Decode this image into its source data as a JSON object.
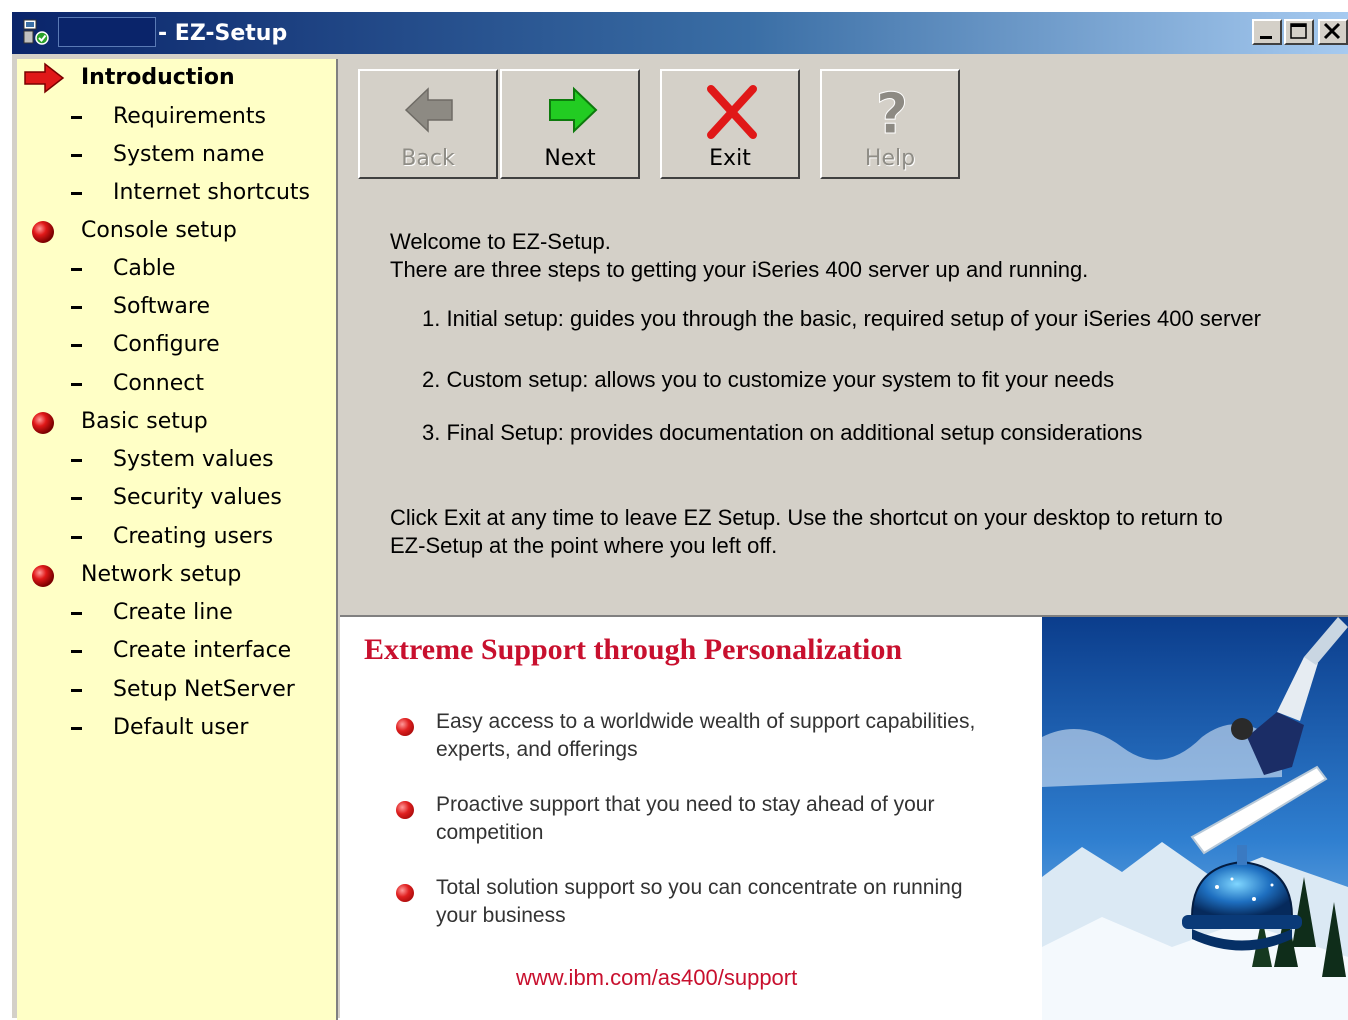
{
  "window": {
    "title": "- EZ-Setup",
    "controls": {
      "minimize": "_",
      "maximize": "□",
      "close": "✕"
    }
  },
  "sidebar": {
    "items": [
      {
        "label": "Introduction",
        "type": "section",
        "current": true
      },
      {
        "label": "Requirements",
        "type": "sub"
      },
      {
        "label": "System name",
        "type": "sub"
      },
      {
        "label": "Internet shortcuts",
        "type": "sub"
      },
      {
        "label": "Console setup",
        "type": "section"
      },
      {
        "label": "Cable",
        "type": "sub"
      },
      {
        "label": "Software",
        "type": "sub"
      },
      {
        "label": "Configure",
        "type": "sub"
      },
      {
        "label": "Connect",
        "type": "sub"
      },
      {
        "label": "Basic setup",
        "type": "section"
      },
      {
        "label": "System values",
        "type": "sub"
      },
      {
        "label": "Security values",
        "type": "sub"
      },
      {
        "label": "Creating users",
        "type": "sub"
      },
      {
        "label": "Network setup",
        "type": "section"
      },
      {
        "label": "Create line",
        "type": "sub"
      },
      {
        "label": "Create interface",
        "type": "sub"
      },
      {
        "label": "Setup NetServer",
        "type": "sub"
      },
      {
        "label": "Default user",
        "type": "sub"
      }
    ]
  },
  "toolbar": {
    "back": {
      "label": "Back",
      "enabled": false,
      "icon": "back-arrow-icon"
    },
    "next": {
      "label": "Next",
      "enabled": true,
      "icon": "next-arrow-icon"
    },
    "exit": {
      "label": "Exit",
      "enabled": true,
      "icon": "exit-x-icon"
    },
    "help": {
      "label": "Help",
      "enabled": false,
      "icon": "help-question-icon"
    }
  },
  "message": {
    "welcome": "Welcome to EZ-Setup.",
    "intro": "There are three steps to getting your iSeries 400 server up and running.",
    "steps": [
      "1. Initial setup: guides you through the basic, required setup of your iSeries 400 server",
      "2. Custom setup: allows you to customize your system to fit your needs",
      "3. Final Setup:  provides documentation on additional setup considerations"
    ],
    "exit_note_line1": "Click Exit at any time to leave EZ Setup. Use the shortcut on your desktop to return to",
    "exit_note_line2": "EZ-Setup at the point where you left off."
  },
  "banner": {
    "title": "Extreme Support through Personalization",
    "bullets": [
      "Easy access to a worldwide wealth of support capabilities, experts, and offerings",
      "Proactive support that you need to stay ahead of your competition",
      "Total solution support so you can concentrate on running your business"
    ],
    "link": "www.ibm.com/as400/support"
  },
  "colors": {
    "sidebar_bg": "#ffffc6",
    "panel_bg": "#d4d0c8",
    "accent_red": "#c8102e",
    "next_green": "#22cc22",
    "titlebar_start": "#0a246a",
    "titlebar_end": "#a6caf0"
  }
}
